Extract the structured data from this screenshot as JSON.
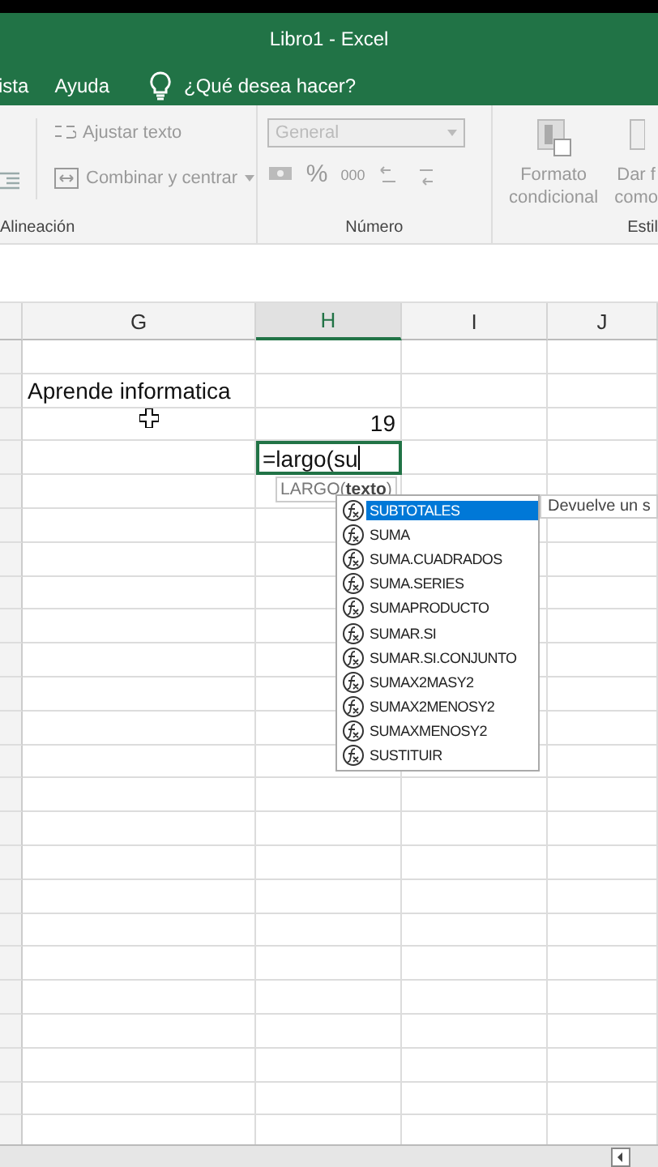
{
  "window": {
    "title": "Libro1  -  Excel"
  },
  "menu": {
    "items": [
      "ista",
      "Ayuda"
    ],
    "tell_me": "¿Qué desea hacer?"
  },
  "ribbon": {
    "alignment": {
      "wrap_text": "Ajustar texto",
      "merge_center": "Combinar y centrar",
      "label": "Alineación"
    },
    "number": {
      "format": "General",
      "percent": "%",
      "thousands": "000",
      "label": "Número"
    },
    "styles": {
      "conditional": [
        "Formato",
        "condicional"
      ],
      "table": [
        "Dar f",
        "como"
      ],
      "label": "Estil"
    }
  },
  "sheet": {
    "columns": [
      {
        "label": "G",
        "selected": false
      },
      {
        "label": "H",
        "selected": true
      },
      {
        "label": "I",
        "selected": false
      },
      {
        "label": "J",
        "selected": false
      }
    ],
    "rows": [
      {
        "cells": [
          {
            "kind": "text",
            "text": "Aprende informatica"
          }
        ]
      },
      {
        "cells": [
          "",
          {
            "kind": "number",
            "text": "19"
          }
        ]
      },
      {
        "cells": [
          "",
          {
            "kind": "editing",
            "text": "=largo(su"
          }
        ]
      }
    ]
  },
  "formula_hint": "LARGO(**texto**)",
  "autocomplete": {
    "items": [
      {
        "label": "SUBTOTALES",
        "selected": true
      },
      {
        "label": "SUMA",
        "selected": false
      },
      {
        "label": "SUMA.CUADRADOS",
        "selected": false
      },
      {
        "label": "SUMA.SERIES",
        "selected": false
      },
      {
        "label": "SUMAPRODUCTO",
        "selected": false
      },
      {
        "label": "SUMAR.SI",
        "selected": false
      },
      {
        "label": "SUMAR.SI.CONJUNTO",
        "selected": false
      },
      {
        "label": "SUMAX2MASY2",
        "selected": false
      },
      {
        "label": "SUMAX2MENOSY2",
        "selected": false
      },
      {
        "label": "SUMAXMENOSY2",
        "selected": false
      },
      {
        "label": "SUSTITUIR",
        "selected": false
      }
    ],
    "tooltip": "Devuelve un s"
  }
}
